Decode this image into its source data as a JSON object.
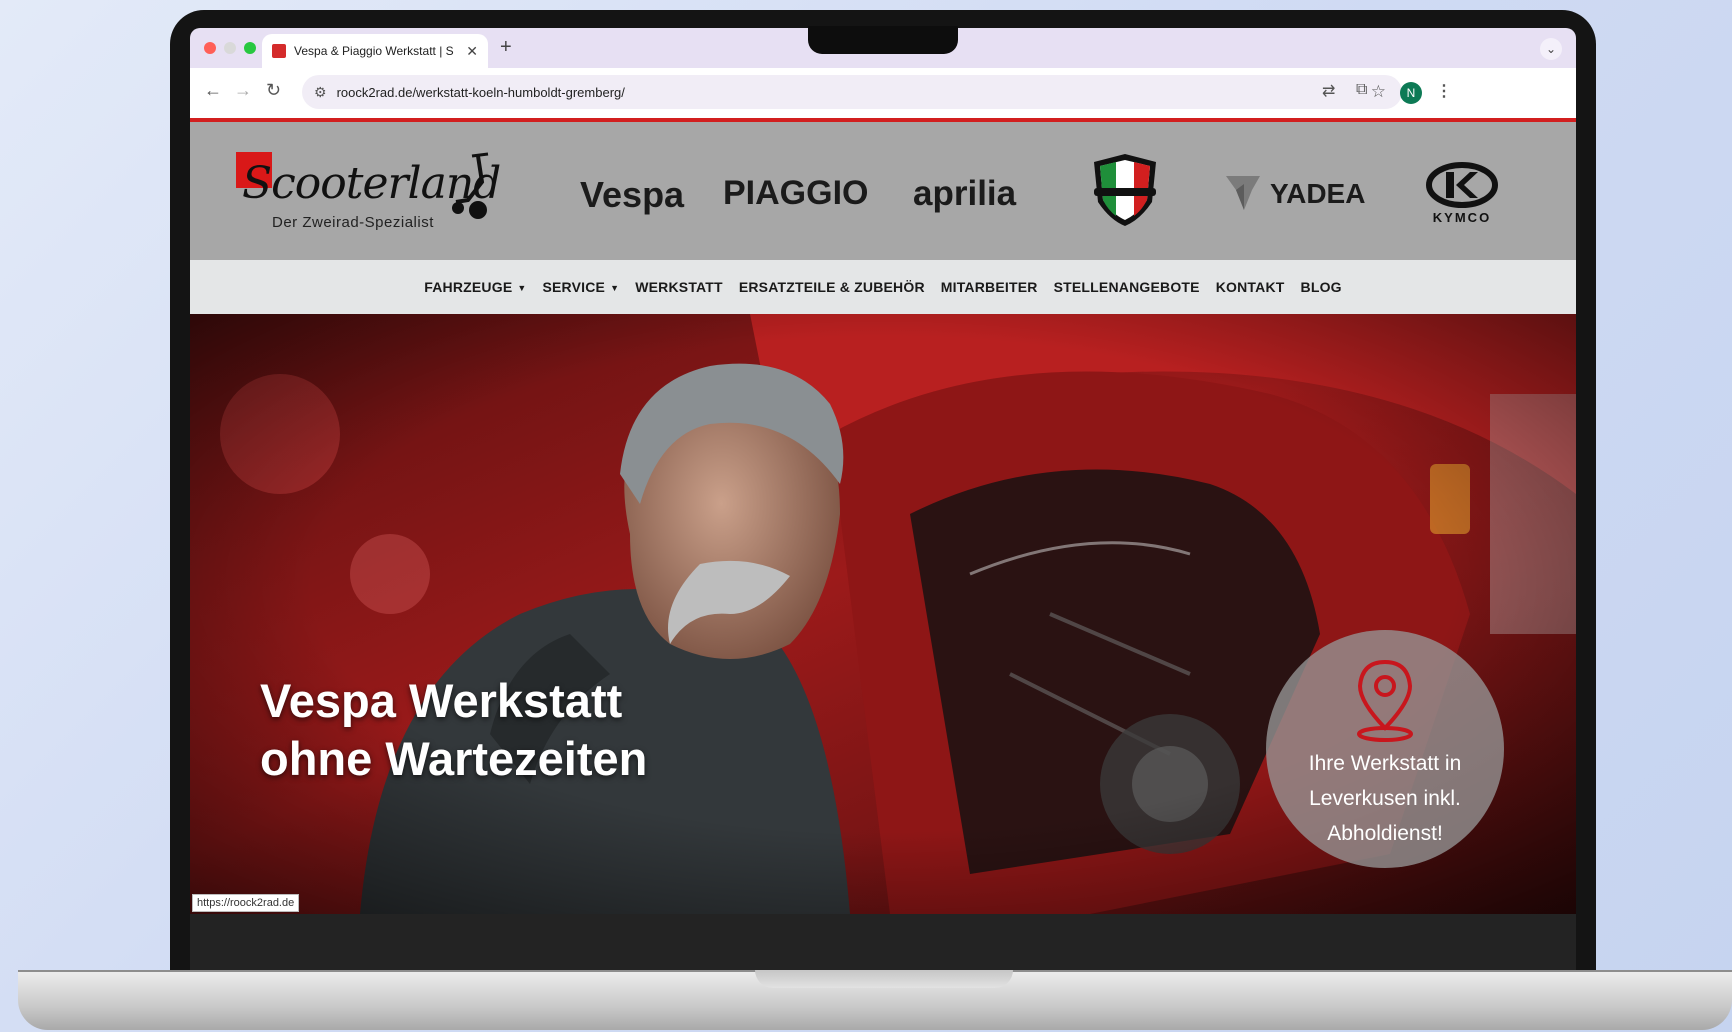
{
  "browser": {
    "tab_title": "Vespa & Piaggio Werkstatt | S",
    "tab_close": "✕",
    "new_tab": "+",
    "url": "roock2rad.de/werkstatt-koeln-humboldt-gremberg/",
    "profile_initial": "N",
    "status_url": "https://roock2rad.de"
  },
  "site": {
    "logo": {
      "word": "Scooterland",
      "tagline": "Der Zweirad-Spezialist"
    },
    "brands": {
      "vespa": "Vespa",
      "piaggio": "PIAGGIO",
      "aprilia": "aprilia",
      "yadea": "YADEA",
      "kymco": "KYMCO"
    },
    "nav": [
      {
        "label": "FAHRZEUGE",
        "dropdown": true
      },
      {
        "label": "SERVICE",
        "dropdown": true
      },
      {
        "label": "WERKSTATT",
        "dropdown": false
      },
      {
        "label": "ERSATZTEILE & ZUBEHÖR",
        "dropdown": false
      },
      {
        "label": "MITARBEITER",
        "dropdown": false
      },
      {
        "label": "STELLENANGEBOTE",
        "dropdown": false
      },
      {
        "label": "KONTAKT",
        "dropdown": false
      },
      {
        "label": "BLOG",
        "dropdown": false
      }
    ],
    "hero": {
      "title_line1": "Vespa Werkstatt",
      "title_line2": "ohne Wartezeiten",
      "badge_line1": "Ihre Werkstatt in",
      "badge_line2": "Leverkusen inkl.",
      "badge_line3": "Abholdienst!"
    }
  },
  "colors": {
    "accent_red": "#d21f1f",
    "header_gray": "#a7a7a7",
    "nav_bg": "#e4e6e7"
  }
}
